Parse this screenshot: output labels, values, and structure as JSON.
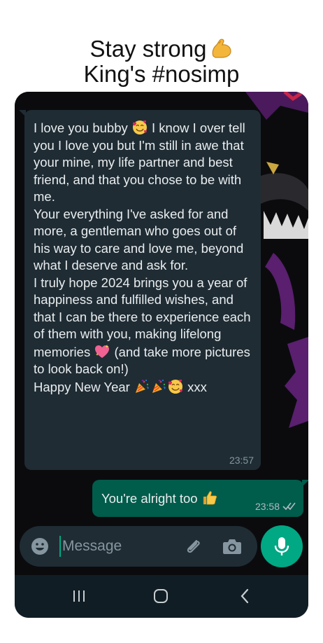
{
  "caption": {
    "line1": "Stay strong",
    "line2": "King's #nosimp",
    "emoji": "flexed-biceps"
  },
  "chat": {
    "incoming": {
      "paragraphs": [
        [
          "I love you bubby ",
          {
            "emoji": "smiling-face-with-hearts"
          },
          " I know I over tell you I love you but I'm still in awe that your mine, my life partner and best friend, and that you chose  to be with me."
        ],
        [
          "Your everything I've asked for and more, a gentleman who goes out of his way to care and love me, beyond what I deserve and ask for."
        ],
        [
          "I truly hope 2024 brings you a year of happiness and fulfilled wishes, and that I can be there to experience each of them with you, making lifelong memories ",
          {
            "emoji": "sparkling-heart"
          },
          " (and take more pictures to look back on!)"
        ],
        [
          "Happy New Year ",
          {
            "emoji": "party-popper"
          },
          {
            "emoji": "party-popper"
          },
          {
            "emoji": "smiling-face-with-hearts"
          },
          " xxx"
        ]
      ],
      "time": "23:57"
    },
    "outgoing": {
      "text": "You're alright too",
      "emoji": "thumbs-up",
      "time": "23:58",
      "status": "read-double-tick"
    }
  },
  "composer": {
    "placeholder": "Message",
    "value": "",
    "icons": [
      "emoji-icon",
      "paperclip-icon",
      "camera-icon",
      "microphone-icon"
    ]
  },
  "navbar": {
    "icons": [
      "recent-apps-icon",
      "home-icon",
      "back-icon"
    ]
  },
  "colors": {
    "background": "#0b0b0e",
    "incoming_bubble": "#1f2c34",
    "outgoing_bubble": "#005c4b",
    "accent": "#00a884",
    "text": "#e9edef",
    "meta": "#8696a0",
    "navbar": "#101d25",
    "wallpaper_purple": "#5a1f6e"
  }
}
